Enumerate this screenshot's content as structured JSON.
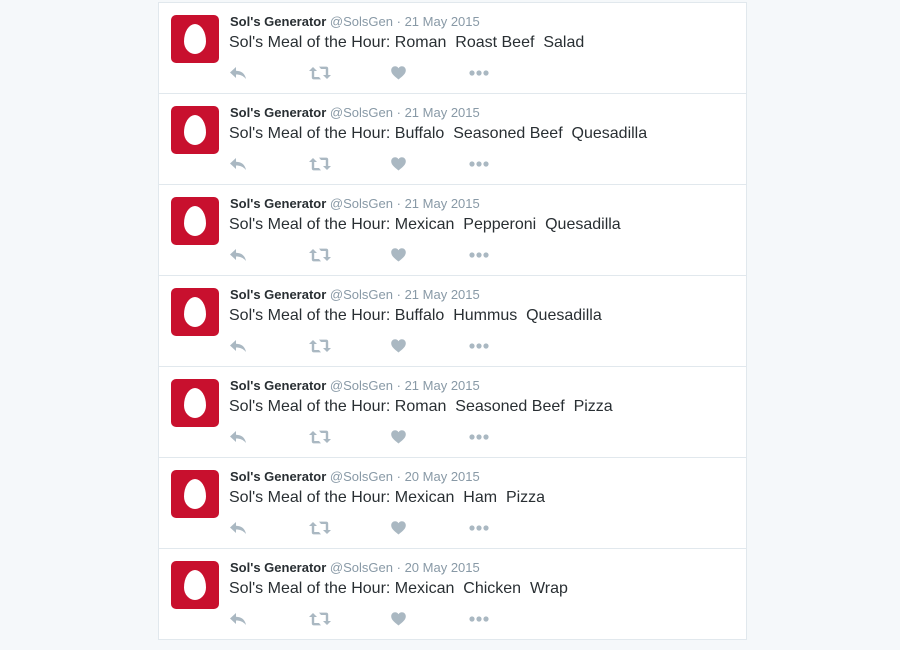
{
  "colors": {
    "avatar": "#c8102e",
    "action_icon": "#aab8c2",
    "text": "#292f33",
    "meta": "#8899a6",
    "border": "#e1e8ed",
    "background": "#f5f8fa"
  },
  "icons": {
    "reply": "reply-icon",
    "retweet": "retweet-icon",
    "like": "heart-icon",
    "more": "more-icon"
  },
  "tweets": [
    {
      "name": "Sol's Generator",
      "handle": "@SolsGen",
      "separator": "·",
      "date": "21 May 2015",
      "text": "Sol's Meal of the Hour: Roman  Roast Beef  Salad"
    },
    {
      "name": "Sol's Generator",
      "handle": "@SolsGen",
      "separator": "·",
      "date": "21 May 2015",
      "text": "Sol's Meal of the Hour: Buffalo  Seasoned Beef  Quesadilla"
    },
    {
      "name": "Sol's Generator",
      "handle": "@SolsGen",
      "separator": "·",
      "date": "21 May 2015",
      "text": "Sol's Meal of the Hour: Mexican  Pepperoni  Quesadilla"
    },
    {
      "name": "Sol's Generator",
      "handle": "@SolsGen",
      "separator": "·",
      "date": "21 May 2015",
      "text": "Sol's Meal of the Hour: Buffalo  Hummus  Quesadilla"
    },
    {
      "name": "Sol's Generator",
      "handle": "@SolsGen",
      "separator": "·",
      "date": "21 May 2015",
      "text": "Sol's Meal of the Hour: Roman  Seasoned Beef  Pizza"
    },
    {
      "name": "Sol's Generator",
      "handle": "@SolsGen",
      "separator": "·",
      "date": "20 May 2015",
      "text": "Sol's Meal of the Hour: Mexican  Ham  Pizza"
    },
    {
      "name": "Sol's Generator",
      "handle": "@SolsGen",
      "separator": "·",
      "date": "20 May 2015",
      "text": "Sol's Meal of the Hour: Mexican  Chicken  Wrap"
    }
  ]
}
